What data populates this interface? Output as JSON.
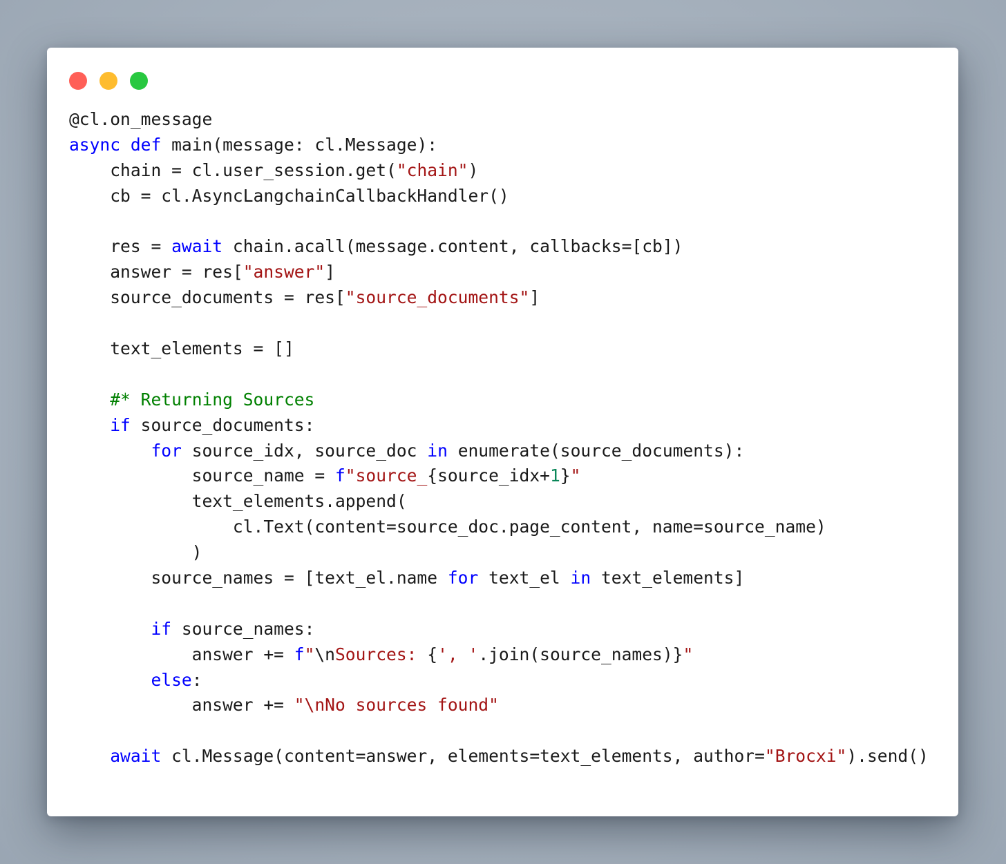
{
  "window": {
    "colors": {
      "close": "#ff5f57",
      "minimize": "#febc2e",
      "zoom": "#28c840",
      "keyword": "#0000ff",
      "string": "#a31515",
      "comment": "#008000",
      "number": "#098658",
      "text": "#1a1a1a"
    }
  },
  "code": {
    "language": "python",
    "lines": [
      [
        {
          "t": "@cl.on_message",
          "c": "id"
        }
      ],
      [
        {
          "t": "async",
          "c": "kw"
        },
        {
          "t": " ",
          "c": "id"
        },
        {
          "t": "def",
          "c": "kw"
        },
        {
          "t": " main(message: cl.Message):",
          "c": "id"
        }
      ],
      [
        {
          "t": "    chain = cl.user_session.get(",
          "c": "id"
        },
        {
          "t": "\"chain\"",
          "c": "str"
        },
        {
          "t": ")",
          "c": "id"
        }
      ],
      [
        {
          "t": "    cb = cl.AsyncLangchainCallbackHandler()",
          "c": "id"
        }
      ],
      [],
      [
        {
          "t": "    res = ",
          "c": "id"
        },
        {
          "t": "await",
          "c": "kw"
        },
        {
          "t": " chain.acall(message.content, callbacks=[cb])",
          "c": "id"
        }
      ],
      [
        {
          "t": "    answer = res[",
          "c": "id"
        },
        {
          "t": "\"answer\"",
          "c": "str"
        },
        {
          "t": "]",
          "c": "id"
        }
      ],
      [
        {
          "t": "    source_documents = res[",
          "c": "id"
        },
        {
          "t": "\"source_documents\"",
          "c": "str"
        },
        {
          "t": "]",
          "c": "id"
        }
      ],
      [],
      [
        {
          "t": "    text_elements = []",
          "c": "id"
        }
      ],
      [],
      [
        {
          "t": "    ",
          "c": "id"
        },
        {
          "t": "#* Returning Sources",
          "c": "cm"
        }
      ],
      [
        {
          "t": "    ",
          "c": "id"
        },
        {
          "t": "if",
          "c": "kw"
        },
        {
          "t": " source_documents:",
          "c": "id"
        }
      ],
      [
        {
          "t": "        ",
          "c": "id"
        },
        {
          "t": "for",
          "c": "kw"
        },
        {
          "t": " source_idx, source_doc ",
          "c": "id"
        },
        {
          "t": "in",
          "c": "kw"
        },
        {
          "t": " enumerate(source_documents):",
          "c": "id"
        }
      ],
      [
        {
          "t": "            source_name = ",
          "c": "id"
        },
        {
          "t": "f",
          "c": "kw"
        },
        {
          "t": "\"source_",
          "c": "str"
        },
        {
          "t": "{source_idx+",
          "c": "id"
        },
        {
          "t": "1",
          "c": "num"
        },
        {
          "t": "}",
          "c": "id"
        },
        {
          "t": "\"",
          "c": "str"
        }
      ],
      [
        {
          "t": "            text_elements.append(",
          "c": "id"
        }
      ],
      [
        {
          "t": "                cl.Text(content=source_doc.page_content, name=source_name)",
          "c": "id"
        }
      ],
      [
        {
          "t": "            )",
          "c": "id"
        }
      ],
      [
        {
          "t": "        source_names = [text_el.name ",
          "c": "id"
        },
        {
          "t": "for",
          "c": "kw"
        },
        {
          "t": " text_el ",
          "c": "id"
        },
        {
          "t": "in",
          "c": "kw"
        },
        {
          "t": " text_elements]",
          "c": "id"
        }
      ],
      [],
      [
        {
          "t": "        ",
          "c": "id"
        },
        {
          "t": "if",
          "c": "kw"
        },
        {
          "t": " source_names:",
          "c": "id"
        }
      ],
      [
        {
          "t": "            answer += ",
          "c": "id"
        },
        {
          "t": "f",
          "c": "kw"
        },
        {
          "t": "\"",
          "c": "str"
        },
        {
          "t": "\\n",
          "c": "id"
        },
        {
          "t": "Sources: ",
          "c": "str"
        },
        {
          "t": "{",
          "c": "id"
        },
        {
          "t": "', '",
          "c": "str"
        },
        {
          "t": ".join(source_names)}",
          "c": "id"
        },
        {
          "t": "\"",
          "c": "str"
        }
      ],
      [
        {
          "t": "        ",
          "c": "id"
        },
        {
          "t": "else",
          "c": "kw"
        },
        {
          "t": ":",
          "c": "id"
        }
      ],
      [
        {
          "t": "            answer += ",
          "c": "id"
        },
        {
          "t": "\"\\nNo sources found\"",
          "c": "str"
        }
      ],
      [],
      [
        {
          "t": "    ",
          "c": "id"
        },
        {
          "t": "await",
          "c": "kw"
        },
        {
          "t": " cl.Message(content=answer, elements=text_elements, author=",
          "c": "id"
        },
        {
          "t": "\"Brocxi\"",
          "c": "str"
        },
        {
          "t": ").send()",
          "c": "id"
        }
      ]
    ]
  }
}
